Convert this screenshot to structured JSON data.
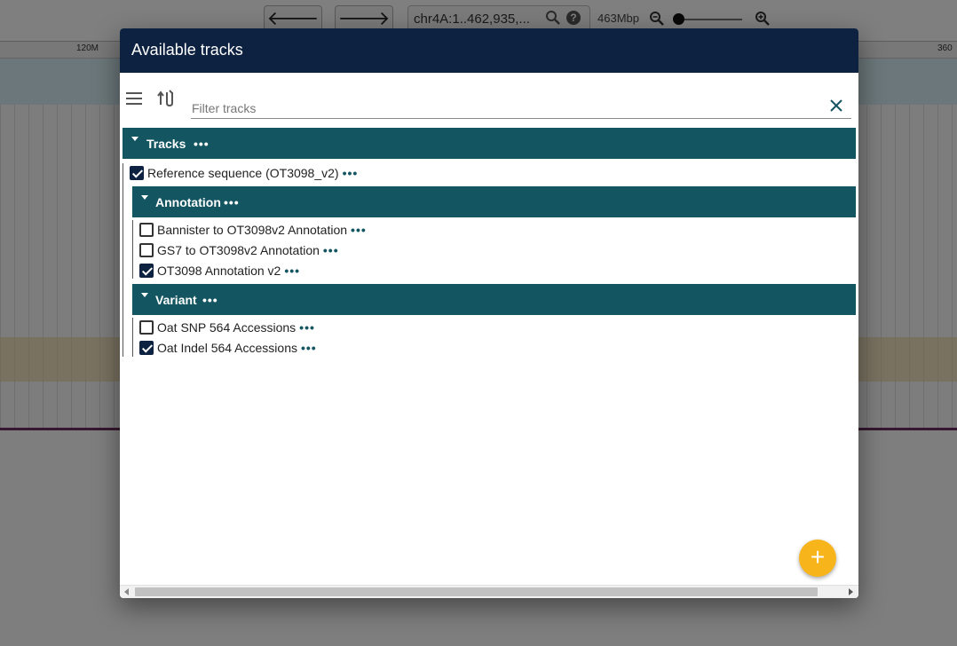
{
  "background": {
    "back_icon": "arrow-left-icon",
    "forward_icon": "arrow-right-icon",
    "back_glyph": "🡐",
    "forward_glyph": "🡒",
    "location": "chr4A:1..462,935,...",
    "help_glyph": "?",
    "bp_label": "463Mbp",
    "ruler_ticks": [
      "120M",
      "360"
    ]
  },
  "dialog": {
    "title": "Available tracks",
    "filter_placeholder": "Filter tracks",
    "menu_icon": "hamburger-menu-icon",
    "sort_icon": "sort-icon",
    "clear_icon": "close-icon"
  },
  "tree": {
    "more_glyph": "•••",
    "categories": {
      "tracks": {
        "label": "Tracks"
      },
      "annotation": {
        "label": "Annotation"
      },
      "variant": {
        "label": "Variant"
      }
    },
    "tracks": {
      "reference": {
        "label": "Reference sequence (OT3098_v2)",
        "checked": true
      },
      "bannister": {
        "label": "Bannister to OT3098v2 Annotation",
        "checked": false
      },
      "gs7": {
        "label": "GS7 to OT3098v2 Annotation",
        "checked": false
      },
      "ot3098": {
        "label": "OT3098 Annotation v2",
        "checked": true
      },
      "snp": {
        "label": "Oat SNP 564 Accessions",
        "checked": false
      },
      "indel": {
        "label": "Oat Indel 564 Accessions",
        "checked": true
      }
    }
  },
  "fab": {
    "glyph": "+",
    "icon": "plus-icon"
  },
  "colors": {
    "header": "#0d2240",
    "category": "#135560",
    "fab": "#f7b51b",
    "checkbox_checked": "#0d2240"
  }
}
